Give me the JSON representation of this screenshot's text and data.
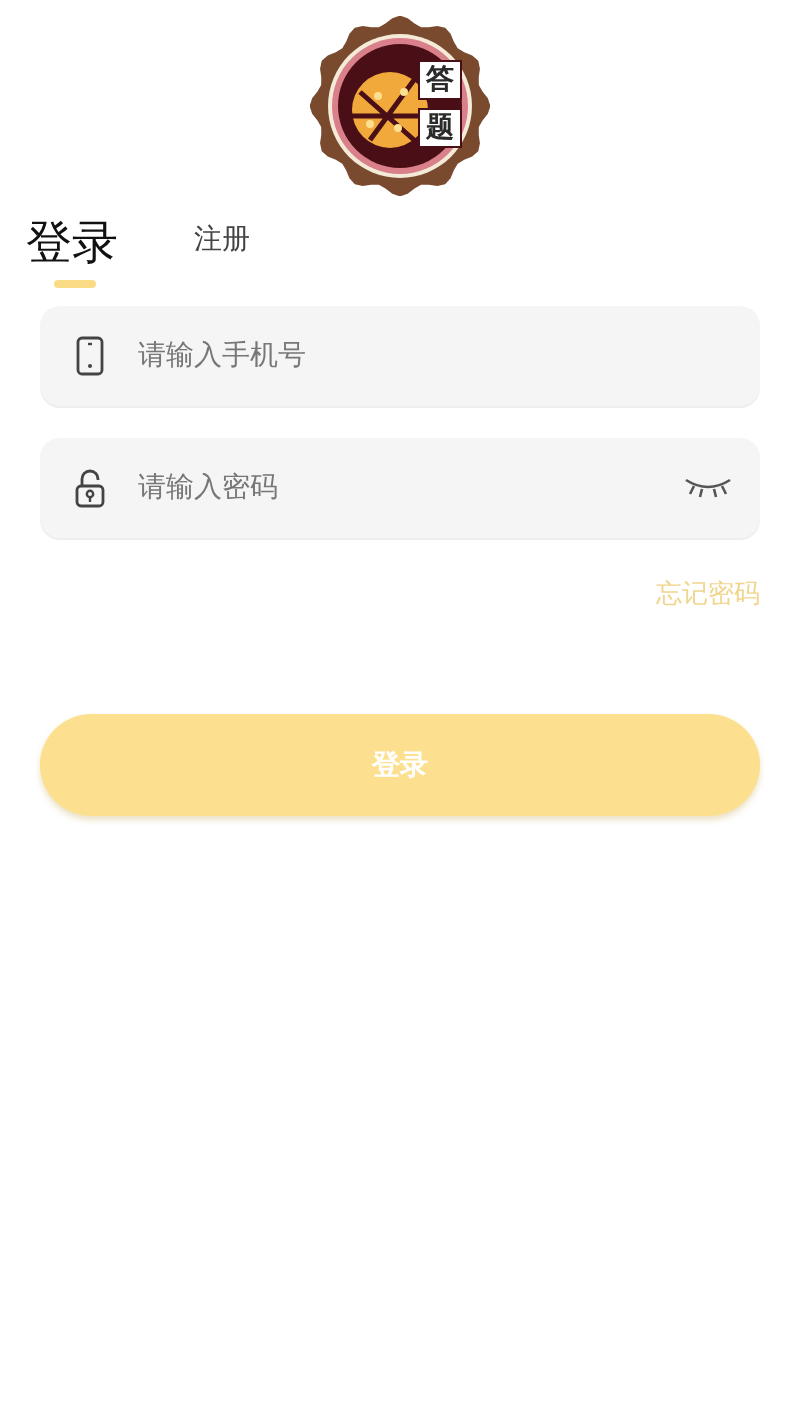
{
  "logo": {
    "characters": [
      "答",
      "题"
    ]
  },
  "tabs": [
    {
      "label": "登录",
      "selected": true
    },
    {
      "label": "注册",
      "selected": false
    }
  ],
  "fields": [
    {
      "kind": "phone",
      "placeholder": "请输入手机号"
    },
    {
      "kind": "password",
      "placeholder": "请输入密码",
      "show_password": false
    }
  ],
  "forgot_password_link": "忘记密码",
  "login_button": "登录"
}
